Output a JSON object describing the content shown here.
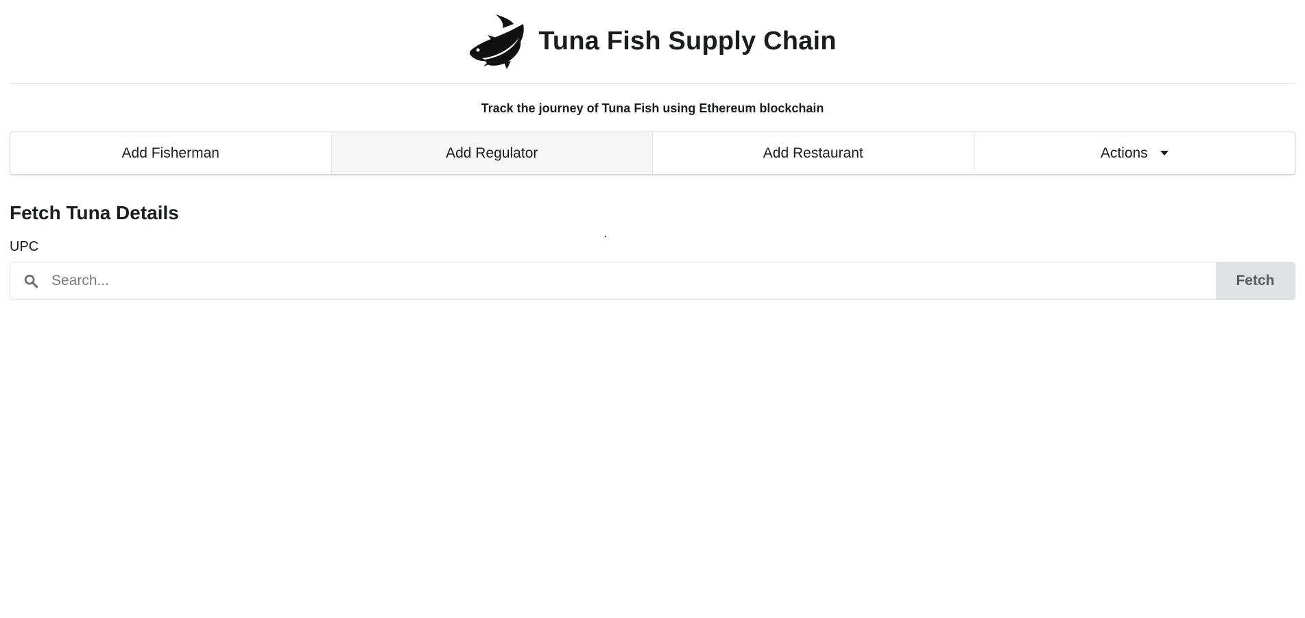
{
  "header": {
    "logo_icon": "tuna-fish-logo",
    "title": "Tuna Fish Supply Chain",
    "subtitle": "Track the journey of Tuna Fish using Ethereum blockchain"
  },
  "menu": {
    "items": [
      {
        "label": "Add Fisherman",
        "active": false
      },
      {
        "label": "Add Regulator",
        "active": true
      },
      {
        "label": "Add Restaurant",
        "active": false
      },
      {
        "label": "Actions",
        "active": false,
        "icon": "caret-down-icon"
      }
    ]
  },
  "fetch": {
    "section_title": "Fetch Tuna Details",
    "field_label": "UPC",
    "search_icon": "search-icon",
    "placeholder": "Search...",
    "value": "",
    "button_label": "Fetch"
  },
  "colors": {
    "active_tab": "#f6f6f6",
    "fetch_button": "#e0e1e2",
    "text": "#1b1c1d"
  }
}
